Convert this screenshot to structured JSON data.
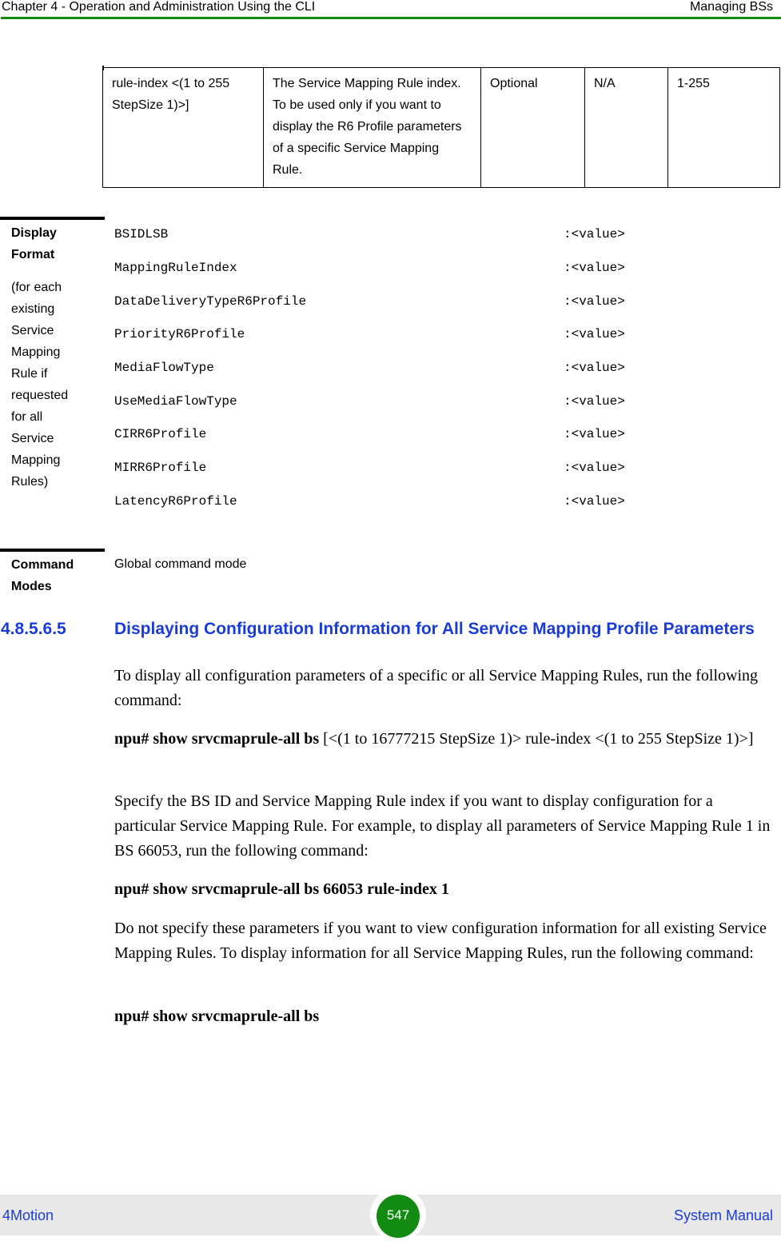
{
  "header": {
    "chapter": "Chapter 4 - Operation and Administration Using the CLI",
    "section": "Managing BSs",
    "accent_color": "#138a12"
  },
  "param_table": {
    "row": {
      "parameter": "rule-index <(1 to 255 StepSize 1)>]",
      "description": "The Service Mapping Rule index. To be used only  if you want to display the R6 Profile parameters of a specific Service Mapping Rule.",
      "presence": "Optional",
      "default": "N/A",
      "range": "1-255"
    }
  },
  "display_format": {
    "label": "Display Format",
    "sublabel": "(for each existing Service Mapping Rule if requested for all Service Mapping Rules)",
    "rows": [
      {
        "name": "BSIDLSB",
        "value": ":<value>"
      },
      {
        "name": "MappingRuleIndex",
        "value": ":<value>"
      },
      {
        "name": "DataDeliveryTypeR6Profile",
        "value": ":<value>"
      },
      {
        "name": "PriorityR6Profile",
        "value": ":<value>"
      },
      {
        "name": "MediaFlowType",
        "value": ":<value>"
      },
      {
        "name": "UseMediaFlowType",
        "value": ":<value>"
      },
      {
        "name": "CIRR6Profile",
        "value": ":<value>"
      },
      {
        "name": "MIRR6Profile",
        "value": ":<value>"
      },
      {
        "name": "LatencyR6Profile",
        "value": ":<value>"
      }
    ]
  },
  "command_modes": {
    "label": "Command Modes",
    "value": "Global command mode"
  },
  "section": {
    "number": "4.8.5.6.5",
    "title": "Displaying Configuration Information for All Service Mapping Profile Parameters",
    "color": "#1a3cd6"
  },
  "body": {
    "intro": "To display all configuration parameters of a specific or all Service Mapping Rules, run the following command:",
    "syntax_bold": "npu# show srvcmaprule-all bs",
    "syntax_rest": " [<(1 to 16777215 StepSize 1)> rule-index <(1 to 255 StepSize 1)>]",
    "specify": "Specify the BS ID and Service Mapping Rule index if you want to display configuration for a particular Service Mapping Rule. For example, to display all parameters of Service Mapping Rule 1 in BS 66053, run the following command:",
    "example_cmd": "npu# show srvcmaprule-all bs 66053 rule-index 1",
    "do_not": "Do not specify these parameters if you want to view configuration information for all existing Service Mapping Rules. To display information for all Service Mapping Rules, run the following command:",
    "all_cmd": "npu# show srvcmaprule-all bs"
  },
  "footer": {
    "left": "4Motion",
    "page": "547",
    "right": "System Manual"
  }
}
